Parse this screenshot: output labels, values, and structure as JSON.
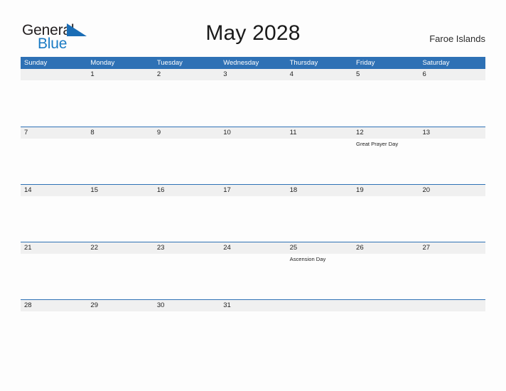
{
  "brand": {
    "name_part1": "General",
    "name_part2": "Blue",
    "flag_icon": "triangle-flag-icon",
    "color_dark": "#231f20",
    "color_blue": "#1a7bc4"
  },
  "header": {
    "title": "May 2028",
    "region": "Faroe Islands"
  },
  "theme": {
    "header_blue": "#2e71b5",
    "row_divider_blue": "#2e71b5",
    "date_band_gray": "#f0f0f0",
    "page_background": "#fdfdfd"
  },
  "calendar": {
    "weekdays": [
      "Sunday",
      "Monday",
      "Tuesday",
      "Wednesday",
      "Thursday",
      "Friday",
      "Saturday"
    ],
    "weeks": [
      {
        "days": [
          {
            "date": "",
            "events": []
          },
          {
            "date": "1",
            "events": []
          },
          {
            "date": "2",
            "events": []
          },
          {
            "date": "3",
            "events": []
          },
          {
            "date": "4",
            "events": []
          },
          {
            "date": "5",
            "events": []
          },
          {
            "date": "6",
            "events": []
          }
        ]
      },
      {
        "days": [
          {
            "date": "7",
            "events": []
          },
          {
            "date": "8",
            "events": []
          },
          {
            "date": "9",
            "events": []
          },
          {
            "date": "10",
            "events": []
          },
          {
            "date": "11",
            "events": []
          },
          {
            "date": "12",
            "events": [
              "Great Prayer Day"
            ]
          },
          {
            "date": "13",
            "events": []
          }
        ]
      },
      {
        "days": [
          {
            "date": "14",
            "events": []
          },
          {
            "date": "15",
            "events": []
          },
          {
            "date": "16",
            "events": []
          },
          {
            "date": "17",
            "events": []
          },
          {
            "date": "18",
            "events": []
          },
          {
            "date": "19",
            "events": []
          },
          {
            "date": "20",
            "events": []
          }
        ]
      },
      {
        "days": [
          {
            "date": "21",
            "events": []
          },
          {
            "date": "22",
            "events": []
          },
          {
            "date": "23",
            "events": []
          },
          {
            "date": "24",
            "events": []
          },
          {
            "date": "25",
            "events": [
              "Ascension Day"
            ]
          },
          {
            "date": "26",
            "events": []
          },
          {
            "date": "27",
            "events": []
          }
        ]
      },
      {
        "days": [
          {
            "date": "28",
            "events": []
          },
          {
            "date": "29",
            "events": []
          },
          {
            "date": "30",
            "events": []
          },
          {
            "date": "31",
            "events": []
          },
          {
            "date": "",
            "events": []
          },
          {
            "date": "",
            "events": []
          },
          {
            "date": "",
            "events": []
          }
        ]
      }
    ]
  }
}
